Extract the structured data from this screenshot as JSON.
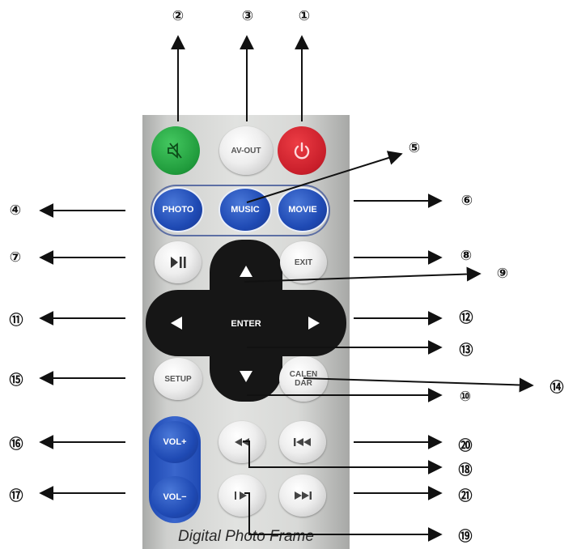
{
  "remote": {
    "brand_text": "Digital Photo Frame",
    "colors": {
      "green": "#1f9a3b",
      "red": "#c81e2a",
      "blue": "#1f4ab4",
      "dark": "#161616",
      "silver": "#e6e6e6"
    },
    "buttons": {
      "mute": {
        "icon": "mute-icon"
      },
      "av_out": {
        "label": "AV-OUT"
      },
      "power": {
        "icon": "power-icon"
      },
      "photo": {
        "label": "PHOTO"
      },
      "music": {
        "label": "MUSIC"
      },
      "movie": {
        "label": "MOVIE"
      },
      "play_pause": {
        "icon": "play-pause-icon"
      },
      "exit": {
        "label": "EXIT"
      },
      "up": {
        "icon": "arrow-up-icon"
      },
      "left": {
        "icon": "arrow-left-icon"
      },
      "enter": {
        "label": "ENTER"
      },
      "right": {
        "icon": "arrow-right-icon"
      },
      "setup": {
        "label": "SETUP"
      },
      "down": {
        "icon": "arrow-down-icon"
      },
      "calendar": {
        "label_line1": "CALEN",
        "label_line2": "DAR"
      },
      "vol_up": {
        "label": "VOL+"
      },
      "vol_down": {
        "label": "VOL−"
      },
      "rewind": {
        "icon": "rewind-icon"
      },
      "previous": {
        "icon": "previous-icon"
      },
      "slow_forward": {
        "icon": "slow-forward-icon"
      },
      "next": {
        "icon": "next-icon"
      }
    }
  },
  "callouts": {
    "c1": "①",
    "c2": "②",
    "c3": "③",
    "c4": "④",
    "c5": "⑤",
    "c6": "⑥",
    "c7": "⑦",
    "c8": "⑧",
    "c9": "⑨",
    "c10": "⑩",
    "c11": "⑪",
    "c12": "⑫",
    "c13": "⑬",
    "c14": "⑭",
    "c15": "⑮",
    "c16": "⑯",
    "c17": "⑰",
    "c18": "⑱",
    "c19": "⑲",
    "c20": "⑳",
    "c21": "㉑"
  }
}
